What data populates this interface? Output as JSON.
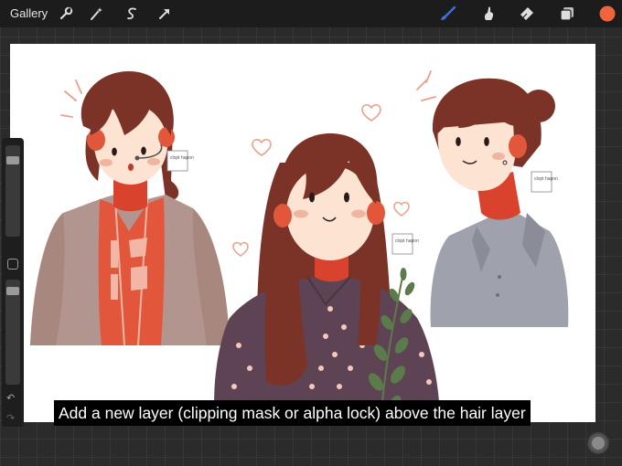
{
  "topbar": {
    "gallery_label": "Gallery",
    "left_tools": [
      "wrench-icon",
      "magic-wand-icon",
      "selection-icon",
      "transform-arrow-icon"
    ],
    "right_tools": [
      "brush-icon",
      "smudge-icon",
      "eraser-icon",
      "layers-icon",
      "color-swatch"
    ],
    "active_tool": "brush-icon",
    "brush_color": "#3b72d9",
    "current_color": "#f0643c"
  },
  "caption": {
    "text": "Add a new layer (clipping mask or alpha lock) above the hair layer"
  },
  "artwork": {
    "name_tag": "clopt hapon",
    "colors": {
      "hair": "#7b3328",
      "skin": "#fde3d2",
      "blush": "#e9a08c",
      "neck": "#d9432e",
      "hoodie": "#b3958f",
      "shirt_red": "#e2573c",
      "dress": "#5d4353",
      "blouse": "#9fa1ad",
      "leaf": "#5c7b4a"
    }
  }
}
